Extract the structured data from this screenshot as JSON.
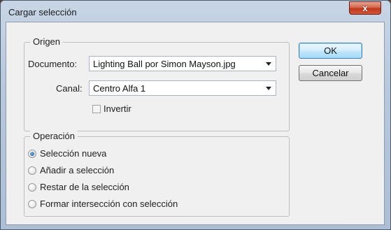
{
  "window": {
    "title": "Cargar selección",
    "close_glyph": "x"
  },
  "origen": {
    "legend": "Origen",
    "documento_label": "Documento:",
    "documento_value": "Lighting Ball por Simon Mayson.jpg",
    "canal_label": "Canal:",
    "canal_value": "Centro Alfa 1",
    "invertir_label": "Invertir",
    "invertir_checked": false
  },
  "operacion": {
    "legend": "Operación",
    "options": [
      {
        "label": "Selección nueva",
        "selected": true
      },
      {
        "label": "Añadir a selección",
        "selected": false
      },
      {
        "label": "Restar de la selección",
        "selected": false
      },
      {
        "label": "Formar intersección con selección",
        "selected": false
      }
    ]
  },
  "buttons": {
    "ok": "OK",
    "cancel": "Cancelar"
  }
}
